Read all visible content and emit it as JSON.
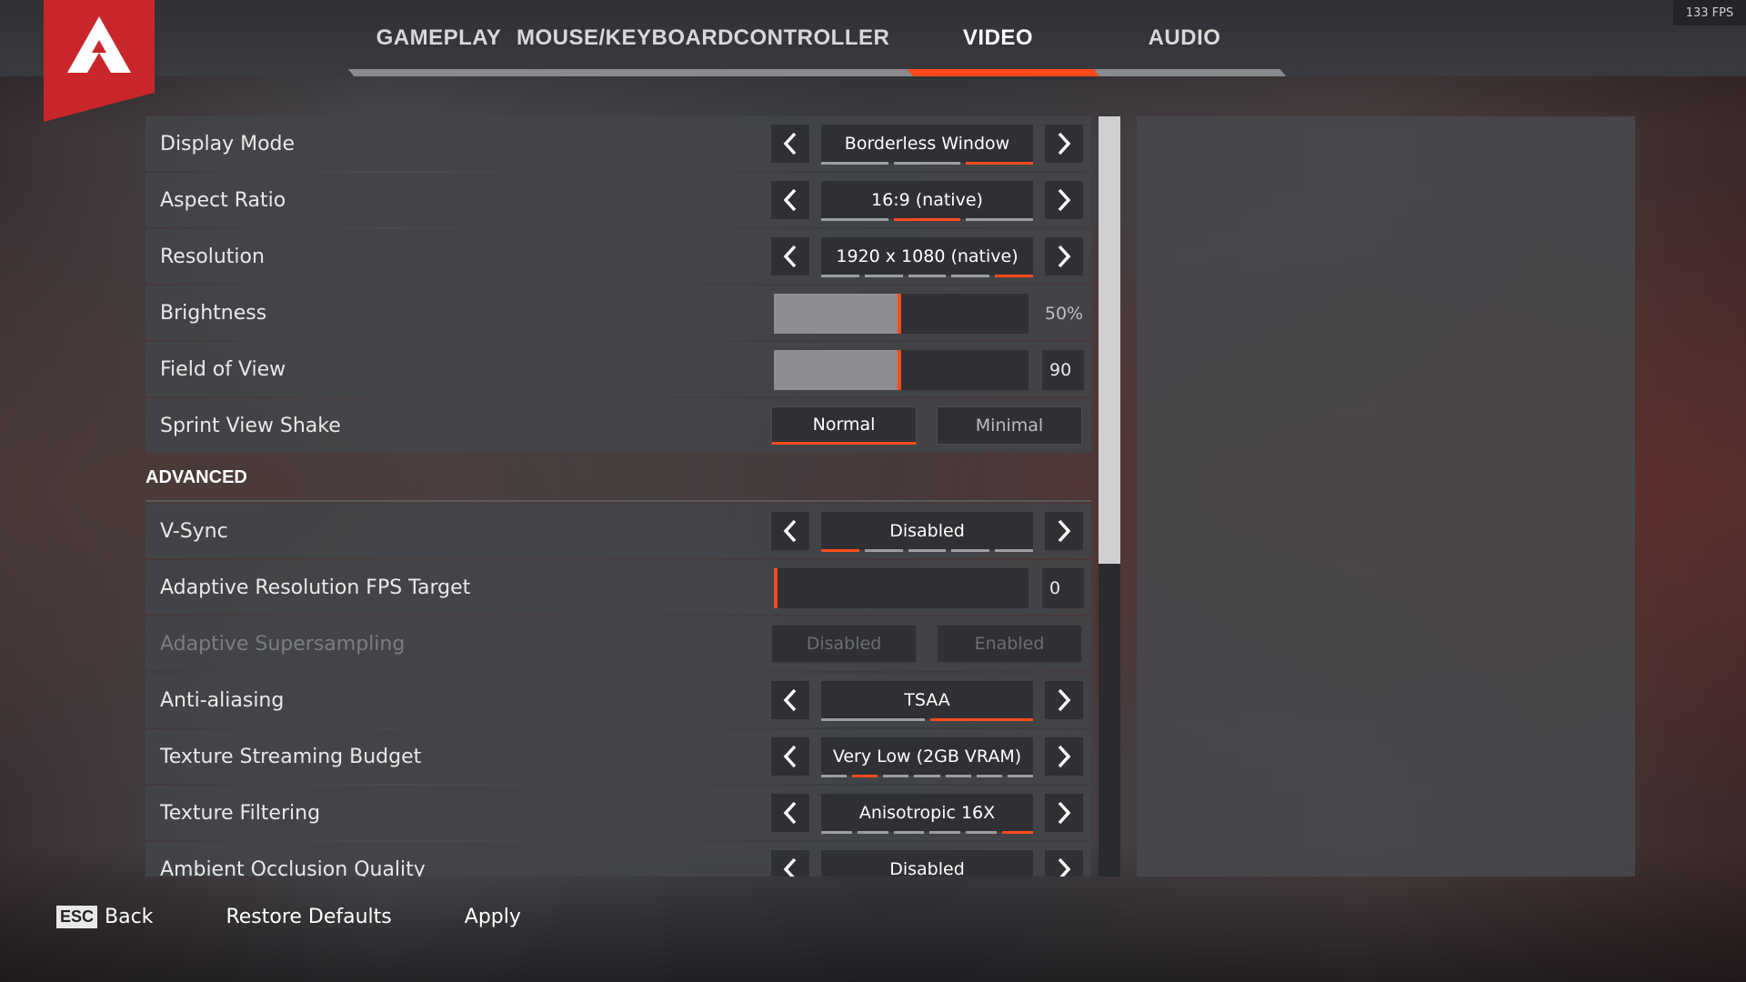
{
  "fps": "133 FPS",
  "tabs": [
    {
      "label": "GAMEPLAY",
      "active": false
    },
    {
      "label": "MOUSE/KEYBOARD",
      "active": false
    },
    {
      "label": "CONTROLLER",
      "active": false
    },
    {
      "label": "VIDEO",
      "active": true
    },
    {
      "label": "AUDIO",
      "active": false
    }
  ],
  "settings": {
    "display_mode": {
      "label": "Display Mode",
      "value": "Borderless Window",
      "options_count": 3,
      "selected_index": 2
    },
    "aspect_ratio": {
      "label": "Aspect Ratio",
      "value": "16:9 (native)",
      "options_count": 3,
      "selected_index": 1
    },
    "resolution": {
      "label": "Resolution",
      "value": "1920 x 1080 (native)",
      "options_count": 5,
      "selected_index": 4
    },
    "brightness": {
      "label": "Brightness",
      "value": "50%",
      "level": 0.5
    },
    "fov": {
      "label": "Field of View",
      "value": "90",
      "level": 0.5
    },
    "sprint_view_shake": {
      "label": "Sprint View Shake",
      "option_a": "Normal",
      "option_b": "Minimal",
      "selected": "a"
    },
    "advanced_title": "ADVANCED",
    "vsync": {
      "label": "V-Sync",
      "value": "Disabled",
      "options_count": 5,
      "selected_index": 0
    },
    "adaptive_fps": {
      "label": "Adaptive Resolution FPS Target",
      "value": "0",
      "level": 0.0
    },
    "adaptive_ss": {
      "label": "Adaptive Supersampling",
      "option_a": "Disabled",
      "option_b": "Enabled"
    },
    "anti_aliasing": {
      "label": "Anti-aliasing",
      "value": "TSAA",
      "options_count": 2,
      "selected_index": 1
    },
    "texture_budget": {
      "label": "Texture Streaming Budget",
      "value": "Very Low (2GB VRAM)",
      "options_count": 7,
      "selected_index": 1
    },
    "texture_filtering": {
      "label": "Texture Filtering",
      "value": "Anisotropic 16X",
      "options_count": 6,
      "selected_index": 5
    },
    "ambient_occlusion": {
      "label": "Ambient Occlusion Quality",
      "value": "Disabled"
    }
  },
  "footer": {
    "esc_key": "ESC",
    "back": "Back",
    "restore": "Restore Defaults",
    "apply": "Apply"
  },
  "colors": {
    "accent": "#ff4a1e",
    "tab_active": "#c92728",
    "logo": "#c8262a"
  }
}
